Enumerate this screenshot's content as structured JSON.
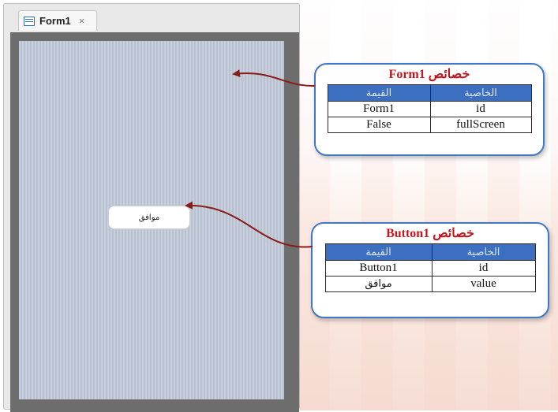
{
  "tab": {
    "title": "Form1",
    "close_glyph": "×",
    "icon": "form-icon"
  },
  "form_button": {
    "label": "موافق"
  },
  "form_props": {
    "title": "خصائص Form1",
    "col_value": "القيمة",
    "col_prop": "الخاصية",
    "rows": [
      {
        "value": "Form1",
        "prop": "id"
      },
      {
        "value": "False",
        "prop": "fullScreen"
      }
    ]
  },
  "button_props": {
    "title": "خصائص Button1",
    "col_value": "القيمة",
    "col_prop": "الخاصية",
    "rows": [
      {
        "value": "Button1",
        "prop": "id"
      },
      {
        "value": "موافق",
        "prop": "value"
      }
    ]
  },
  "colors": {
    "accent": "#3f78c8",
    "title_red": "#c4161c",
    "arrow": "#8b1a1a",
    "header_blue": "#3d6fc0"
  }
}
